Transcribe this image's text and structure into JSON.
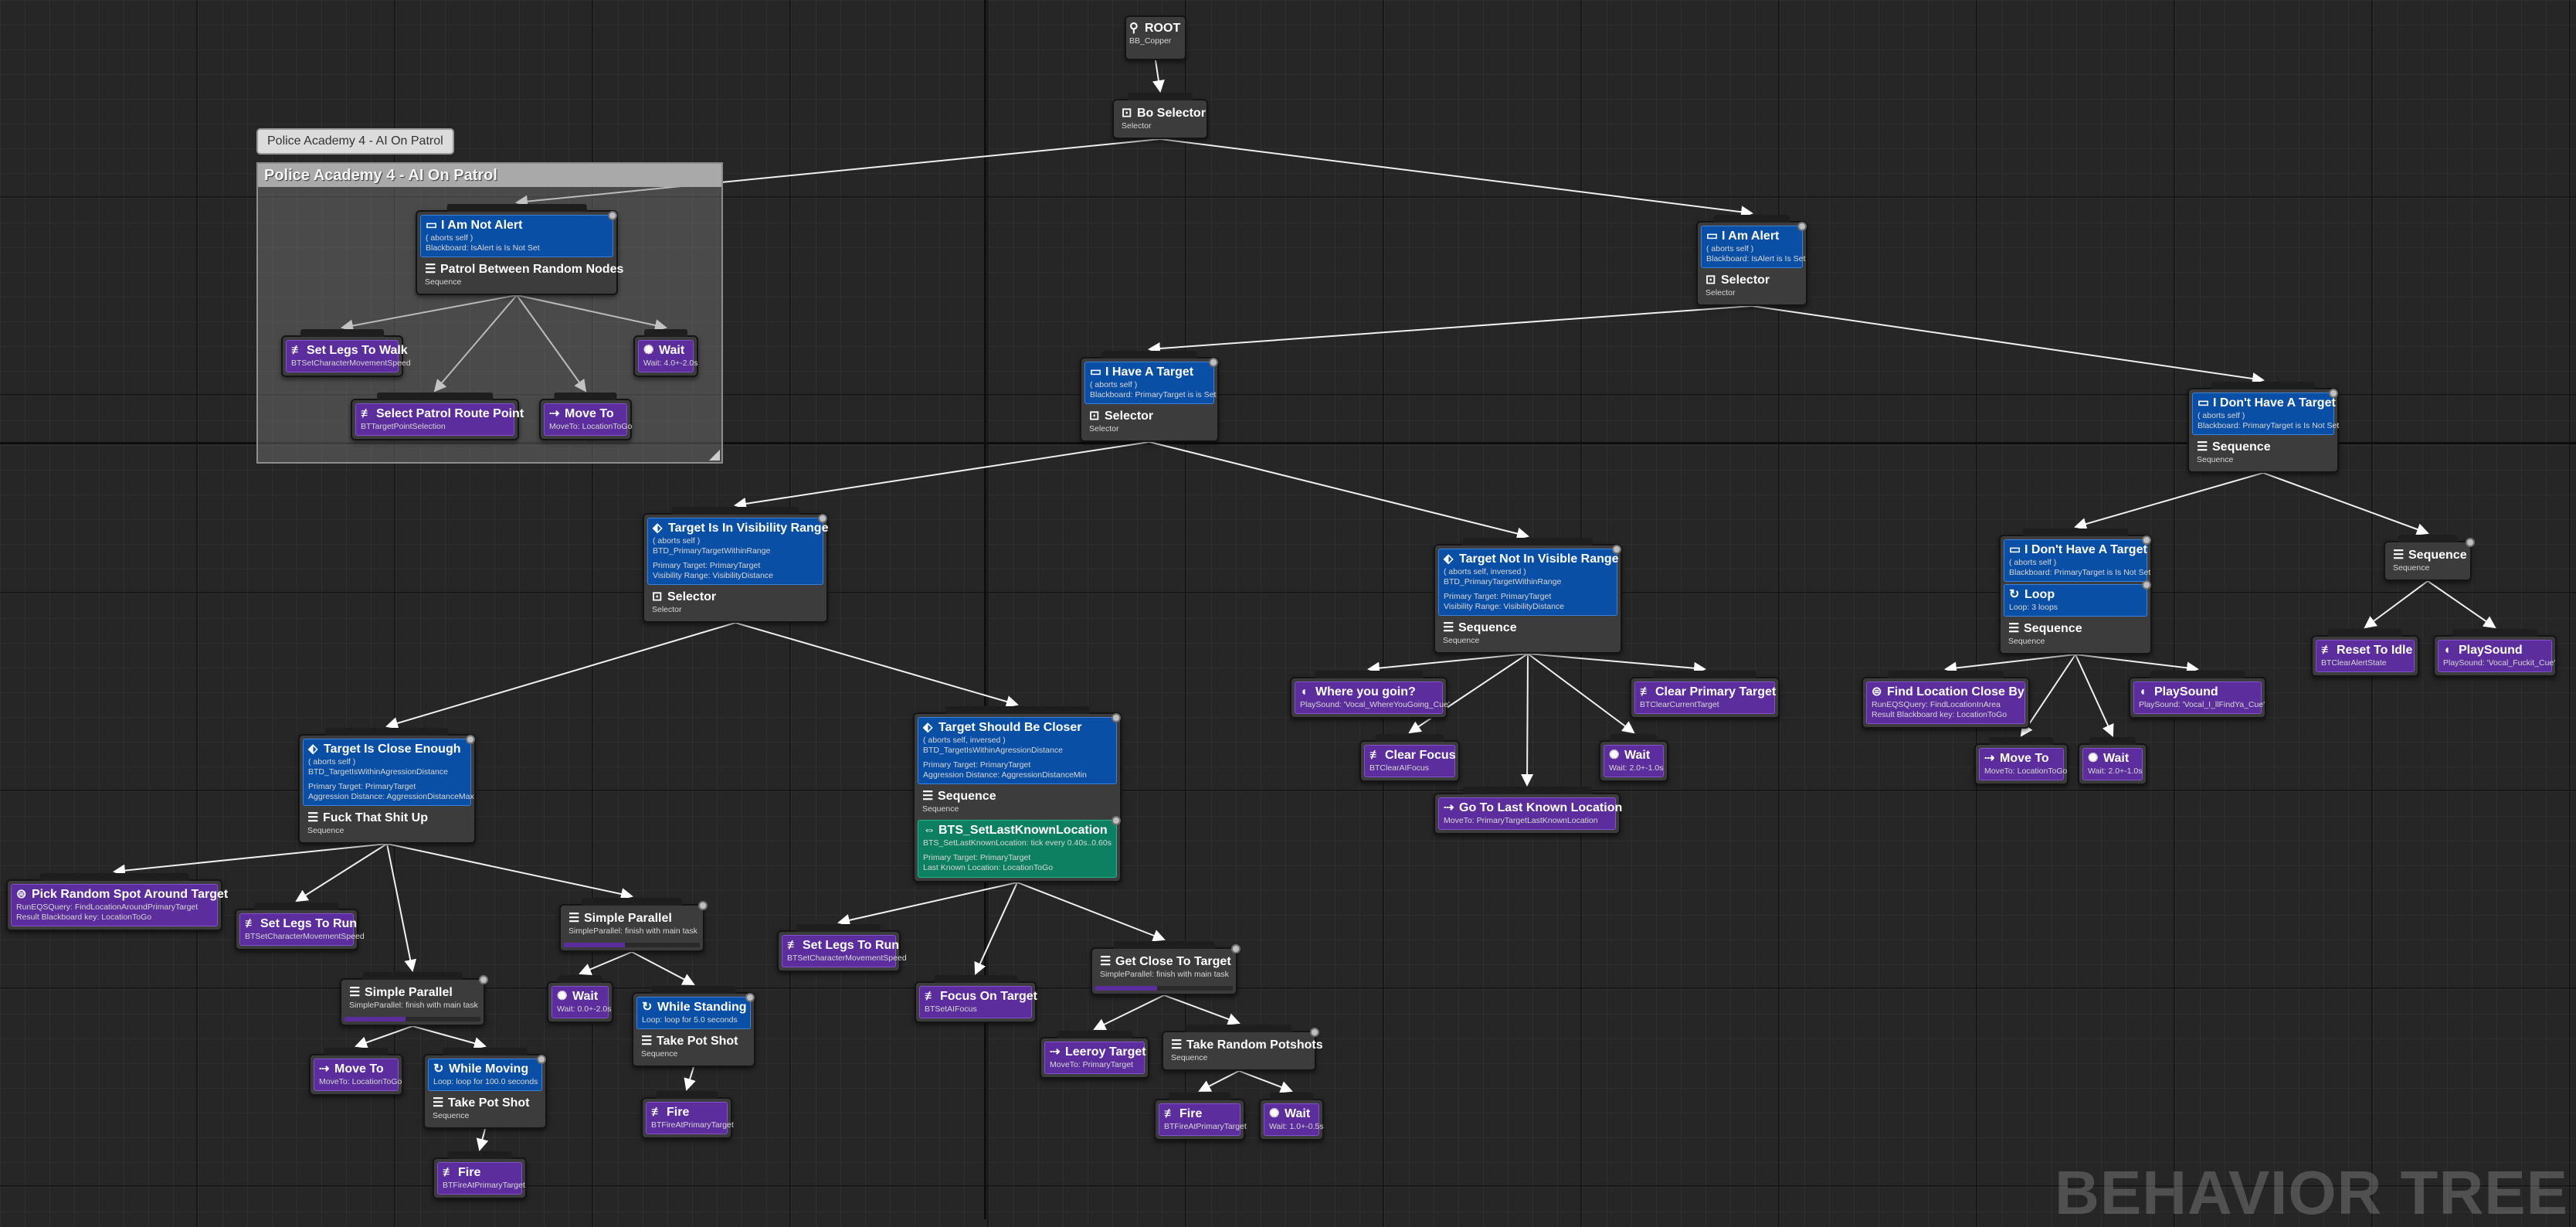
{
  "graph": {
    "watermark": "BEHAVIOR TREE"
  },
  "comment": {
    "text": "Police Academy 4 - AI On Patrol"
  },
  "root": {
    "title": "ROOT",
    "blackboard": "BB_Copper"
  },
  "nodes": {
    "bo_selector": {
      "title": "Bo Selector",
      "type": "Selector"
    },
    "not_alert": {
      "decorator": {
        "title": "I Am Not Alert",
        "lines": [
          "( aborts self )",
          "Blackboard: IsAlert is Is Not Set"
        ]
      },
      "title": "Patrol Between Random Nodes",
      "type": "Sequence"
    },
    "set_legs_walk": {
      "title": "Set Legs To Walk",
      "sub": "BTSetCharacterMovementSpeed"
    },
    "wait_patrol": {
      "title": "Wait",
      "sub": "Wait: 4.0+-2.0s"
    },
    "select_patrol": {
      "title": "Select Patrol Route Point",
      "sub": "BTTargetPointSelection"
    },
    "move_to_patrol": {
      "title": "Move To",
      "sub": "MoveTo: LocationToGo"
    },
    "alert": {
      "decorator": {
        "title": "I Am Alert",
        "lines": [
          "( aborts self )",
          "Blackboard: IsAlert is Is Set"
        ]
      },
      "title": "Selector",
      "type": "Selector"
    },
    "have_target": {
      "decorator": {
        "title": "I Have A Target",
        "lines": [
          "( aborts self )",
          "Blackboard: PrimaryTarget is is Set"
        ]
      },
      "title": "Selector",
      "type": "Selector"
    },
    "no_target": {
      "decorator": {
        "title": "I Don't Have A Target",
        "lines": [
          "( aborts self )",
          "Blackboard: PrimaryTarget is Is Not Set"
        ]
      },
      "title": "Sequence",
      "type": "Sequence"
    },
    "in_vis_range": {
      "decorator": {
        "title": "Target Is In Visibility Range",
        "lines": [
          "( aborts self )",
          "BTD_PrimaryTargetWithinRange"
        ],
        "params": [
          "Primary Target: PrimaryTarget",
          "Visibility Range: VisibilityDistance"
        ]
      },
      "title": "Selector",
      "type": "Selector"
    },
    "not_vis_range": {
      "decorator": {
        "title": "Target Not In Visible Range",
        "lines": [
          "( aborts self, inversed )",
          "BTD_PrimaryTargetWithinRange"
        ],
        "params": [
          "Primary Target: PrimaryTarget",
          "Visibility Range: VisibilityDistance"
        ]
      },
      "title": "Sequence",
      "type": "Sequence"
    },
    "no_target_loop": {
      "decorator": {
        "title": "I Don't Have A Target",
        "lines": [
          "( aborts self )",
          "Blackboard: PrimaryTarget is Is Not Set"
        ]
      },
      "loop": {
        "title": "Loop",
        "sub": "Loop: 3 loops"
      },
      "title": "Sequence",
      "type": "Sequence"
    },
    "seq_right": {
      "title": "Sequence",
      "type": "Sequence"
    },
    "reset_idle": {
      "title": "Reset To Idle",
      "sub": "BTClearAlertState"
    },
    "playsound_right": {
      "title": "PlaySound",
      "sub": "PlaySound: 'Vocal_Fuckit_Cue'"
    },
    "close_enough": {
      "decorator": {
        "title": "Target Is Close Enough",
        "lines": [
          "( aborts self )",
          "BTD_TargetIsWithinAgressionDistance"
        ],
        "params": [
          "Primary Target: PrimaryTarget",
          "Aggression Distance: AggressionDistanceMax"
        ]
      },
      "title": "Fuck That Shit Up",
      "type": "Sequence"
    },
    "should_closer": {
      "decorator": {
        "title": "Target Should Be Closer",
        "lines": [
          "( aborts self, inversed )",
          "BTD_TargetIsWithinAgressionDistance"
        ],
        "params": [
          "Primary Target: PrimaryTarget",
          "Aggression Distance: AggressionDistanceMin"
        ]
      },
      "title": "Sequence",
      "type": "Sequence",
      "service": {
        "title": "BTS_SetLastKnownLocation",
        "lines": [
          "BTS_SetLastKnownLocation: tick every 0.40s..0.60s"
        ],
        "params": [
          "Primary Target: PrimaryTarget",
          "Last Known Location: LocationToGo"
        ]
      }
    },
    "where_goin": {
      "title": "Where you goin?",
      "sub": "PlaySound: 'Vocal_WhereYouGoing_Cue'"
    },
    "clear_primary": {
      "title": "Clear Primary Target",
      "sub": "BTClearCurrentTarget"
    },
    "clear_focus": {
      "title": "Clear Focus",
      "sub": "BTClearAIFocus"
    },
    "wait_nvr": {
      "title": "Wait",
      "sub": "Wait: 2.0+-1.0s"
    },
    "go_last_known": {
      "title": "Go To Last Known Location",
      "sub": "MoveTo: PrimaryTargetLastKnownLocation"
    },
    "find_loc": {
      "title": "Find Location Close By",
      "sub": "RunEQSQuery: FindLocationInArea",
      "sub2": "Result Blackboard key: LocationToGo"
    },
    "playsound_ndt": {
      "title": "PlaySound",
      "sub": "PlaySound: 'Vocal_I_llFindYa_Cue'"
    },
    "move_to_ndt": {
      "title": "Move To",
      "sub": "MoveTo: LocationToGo"
    },
    "wait_ndt": {
      "title": "Wait",
      "sub": "Wait: 2.0+-1.0s"
    },
    "pick_random": {
      "title": "Pick Random Spot Around Target",
      "sub": "RunEQSQuery: FindLocationAroundPrimaryTarget",
      "sub2": "Result Blackboard key: LocationToGo"
    },
    "set_legs_run_1": {
      "title": "Set Legs To Run",
      "sub": "BTSetCharacterMovementSpeed"
    },
    "simple_par_1": {
      "title": "Simple Parallel",
      "sub": "SimpleParallel: finish with main task"
    },
    "wait_sp1": {
      "title": "Wait",
      "sub": "Wait: 0.0+-2.0s"
    },
    "while_standing": {
      "loop": {
        "title": "While Standing",
        "sub": "Loop: loop for 5.0 seconds"
      },
      "title": "Take Pot Shot",
      "type": "Sequence"
    },
    "fire_1": {
      "title": "Fire",
      "sub": "BTFireAtPrimaryTarget"
    },
    "simple_par_2": {
      "title": "Simple Parallel",
      "sub": "SimpleParallel: finish with main task"
    },
    "move_to_sp2": {
      "title": "Move To",
      "sub": "MoveTo: LocationToGo"
    },
    "while_moving": {
      "loop": {
        "title": "While Moving",
        "sub": "Loop: loop for 100.0 seconds"
      },
      "title": "Take Pot Shot",
      "type": "Sequence"
    },
    "fire_2": {
      "title": "Fire",
      "sub": "BTFireAtPrimaryTarget"
    },
    "set_legs_run_2": {
      "title": "Set Legs To Run",
      "sub": "BTSetCharacterMovementSpeed"
    },
    "focus_target": {
      "title": "Focus On Target",
      "sub": "BTSetAIFocus"
    },
    "get_close": {
      "title": "Get Close To Target",
      "sub": "SimpleParallel: finish with main task"
    },
    "leeroy": {
      "title": "Leeroy Target",
      "sub": "MoveTo: PrimaryTarget"
    },
    "random_potshots": {
      "title": "Take Random Potshots",
      "type": "Sequence"
    },
    "fire_3": {
      "title": "Fire",
      "sub": "BTFireAtPrimaryTarget"
    },
    "wait_pots": {
      "title": "Wait",
      "sub": "Wait: 1.0+-0.5s"
    }
  }
}
